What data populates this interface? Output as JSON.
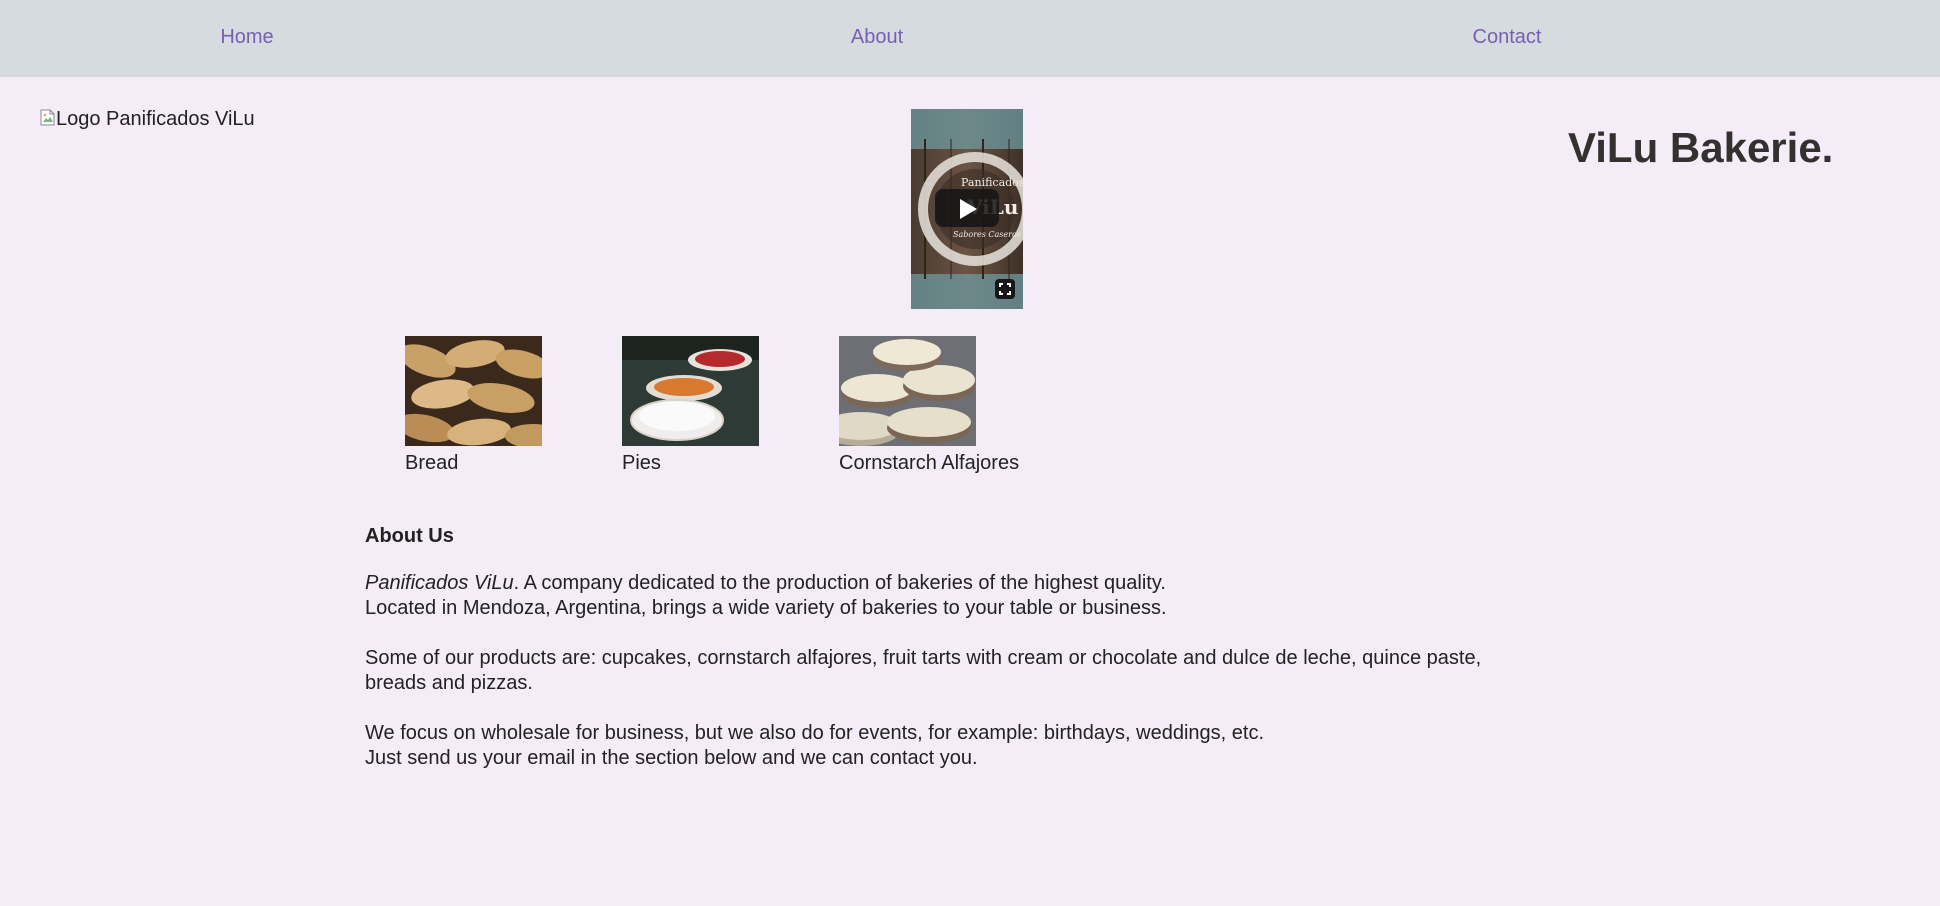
{
  "nav": {
    "home": "Home",
    "about": "About",
    "contact": "Contact"
  },
  "header": {
    "logo_alt": "Logo Panificados ViLu",
    "title": "ViLu Bakerie."
  },
  "video": {
    "overlay_text_1": "Panificados",
    "overlay_text_2": "ViLu",
    "overlay_text_3": "Sabores Caseros",
    "play_icon": "play-icon",
    "fullscreen_icon": "fullscreen-icon"
  },
  "products": [
    {
      "label": "Bread"
    },
    {
      "label": "Pies"
    },
    {
      "label": "Cornstarch Alfajores"
    }
  ],
  "about": {
    "heading": "About Us",
    "p1_brand": "Panificados ViLu",
    "p1_rest": ". A company dedicated to the production of bakeries of the highest quality.",
    "p1_line2": "Located in Mendoza, Argentina, brings a wide variety of bakeries to your table or business.",
    "p2": "Some of our products are: cupcakes, cornstarch alfajores, fruit tarts with cream or chocolate and dulce de leche, quince paste, breads and pizzas.",
    "p3_line1": "We focus on wholesale for business, but we also do for events, for example: birthdays, weddings, etc.",
    "p3_line2": "Just send us your email in the section below and we can contact you."
  },
  "colors": {
    "background": "#f4ecf7",
    "nav_background": "#d6dbe0",
    "nav_link": "#7760b0",
    "title": "#333030"
  }
}
